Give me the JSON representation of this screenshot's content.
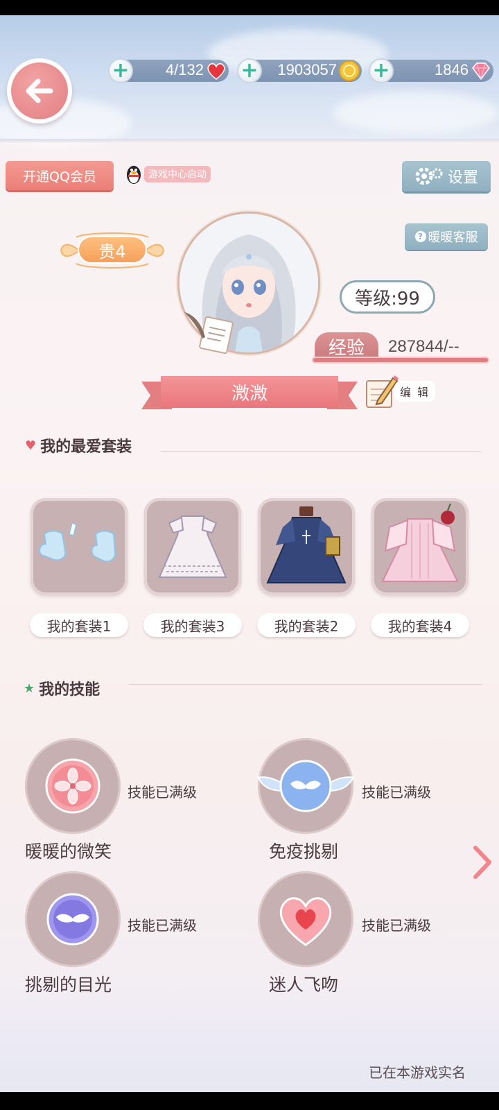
{
  "resources": {
    "stamina": "4/132",
    "gold": "1903057",
    "diamonds": "1846"
  },
  "header": {
    "qq_vip_label": "开通QQ会员",
    "qq_launch_label": "游戏中心启动",
    "settings_label": "设置",
    "service_label": "暖暖客服"
  },
  "profile": {
    "noble_rank": "贵4",
    "level_label": "等级:99",
    "exp_label": "经验",
    "exp_value": "287844/--",
    "nickname": "溦溦",
    "edit_label": "编 辑"
  },
  "favorites": {
    "title": "我的最爱套装",
    "outfits": [
      {
        "label": "我的套装1",
        "icon": "socks-icon"
      },
      {
        "label": "我的套装3",
        "icon": "white-dress-icon"
      },
      {
        "label": "我的套装2",
        "icon": "navy-dress-icon"
      },
      {
        "label": "我的套装4",
        "icon": "pink-dress-icon"
      }
    ]
  },
  "skills": {
    "title": "我的技能",
    "items": [
      {
        "name": "暖暖的微笑",
        "status": "技能已满级",
        "icon": "sakura-icon"
      },
      {
        "name": "免疫挑剔",
        "status": "技能已满级",
        "icon": "winged-mask-icon"
      },
      {
        "name": "挑剔的目光",
        "status": "技能已满级",
        "icon": "purple-mask-icon"
      },
      {
        "name": "迷人飞吻",
        "status": "技能已满级",
        "icon": "heart-icon"
      }
    ]
  },
  "footer": {
    "realname_text": "已在本游戏实名"
  },
  "colors": {
    "accent_pink": "#e8777c",
    "settings_blue": "#8fb0c0",
    "noble_orange": "#f6a05c"
  }
}
